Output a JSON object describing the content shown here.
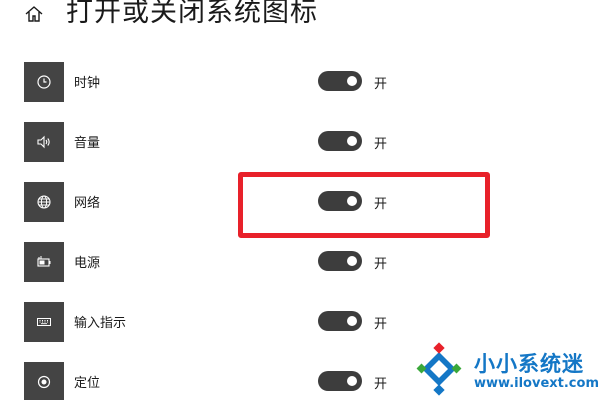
{
  "header": {
    "title": "打开或关闭系统图标",
    "home_icon": "home-icon"
  },
  "rows": [
    {
      "label": "时钟",
      "icon": "clock-icon",
      "state_label": "开",
      "on": true
    },
    {
      "label": "音量",
      "icon": "volume-icon",
      "state_label": "开",
      "on": true
    },
    {
      "label": "网络",
      "icon": "globe-icon",
      "state_label": "开",
      "on": true
    },
    {
      "label": "电源",
      "icon": "battery-icon",
      "state_label": "开",
      "on": true
    },
    {
      "label": "输入指示",
      "icon": "keyboard-icon",
      "state_label": "开",
      "on": true
    },
    {
      "label": "定位",
      "icon": "location-icon",
      "state_label": "开",
      "on": true
    }
  ],
  "annotation": {
    "highlight_color": "#e8212a"
  },
  "watermark": {
    "name": "小小系统迷",
    "url": "www.ilovext.com",
    "color": "#1477c6"
  },
  "colors": {
    "icon_tile": "#444444",
    "toggle_on": "#3d3d3d"
  }
}
